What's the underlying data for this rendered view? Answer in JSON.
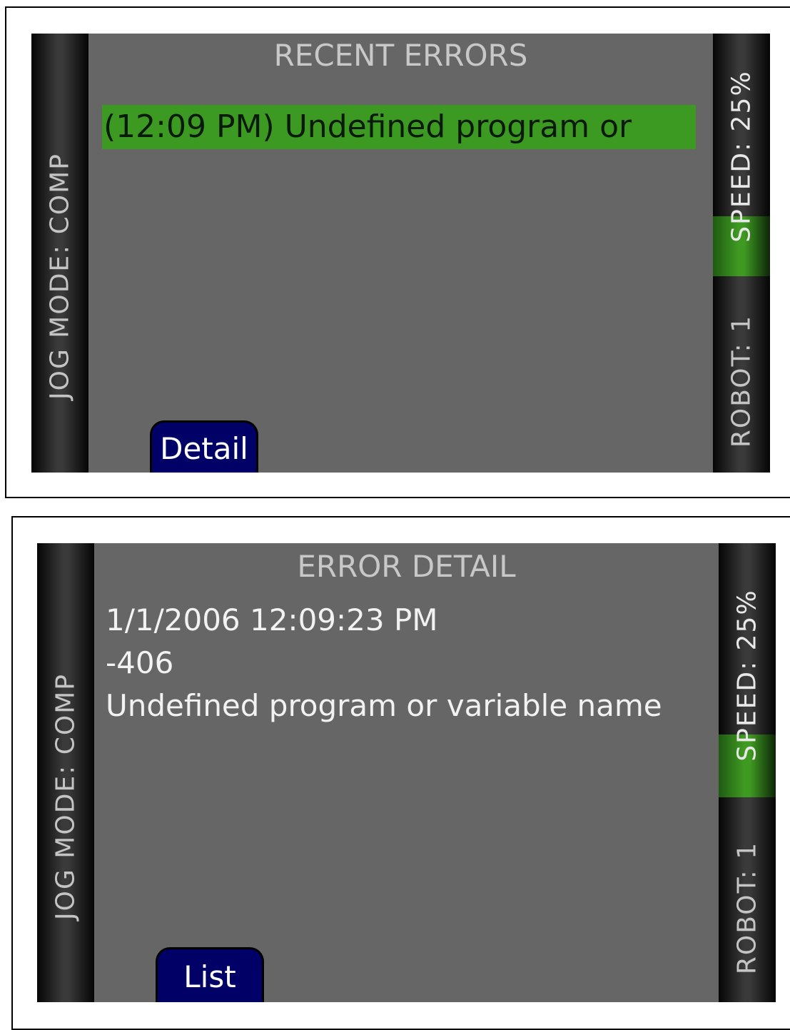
{
  "recent_errors_screen": {
    "title": "RECENT ERRORS",
    "jog_mode": "JOG MODE: COMP",
    "speed": "SPEED: 25%",
    "robot": "ROBOT: 1",
    "errors": [
      {
        "text": "(12:09 PM) Undefined program or",
        "selected": true
      }
    ],
    "detail_button": "Detail"
  },
  "error_detail_screen": {
    "title": "ERROR DETAIL",
    "jog_mode": "JOG MODE: COMP",
    "speed": "SPEED: 25%",
    "robot": "ROBOT: 1",
    "timestamp": "1/1/2006 12:09:23 PM",
    "code": "-406",
    "message": "Undefined program or variable name",
    "list_button": "List"
  },
  "colors": {
    "screen_bg": "#666666",
    "highlight_green": "#3c9a22",
    "button_navy": "#000066",
    "side_bar_dark": "#050505"
  }
}
